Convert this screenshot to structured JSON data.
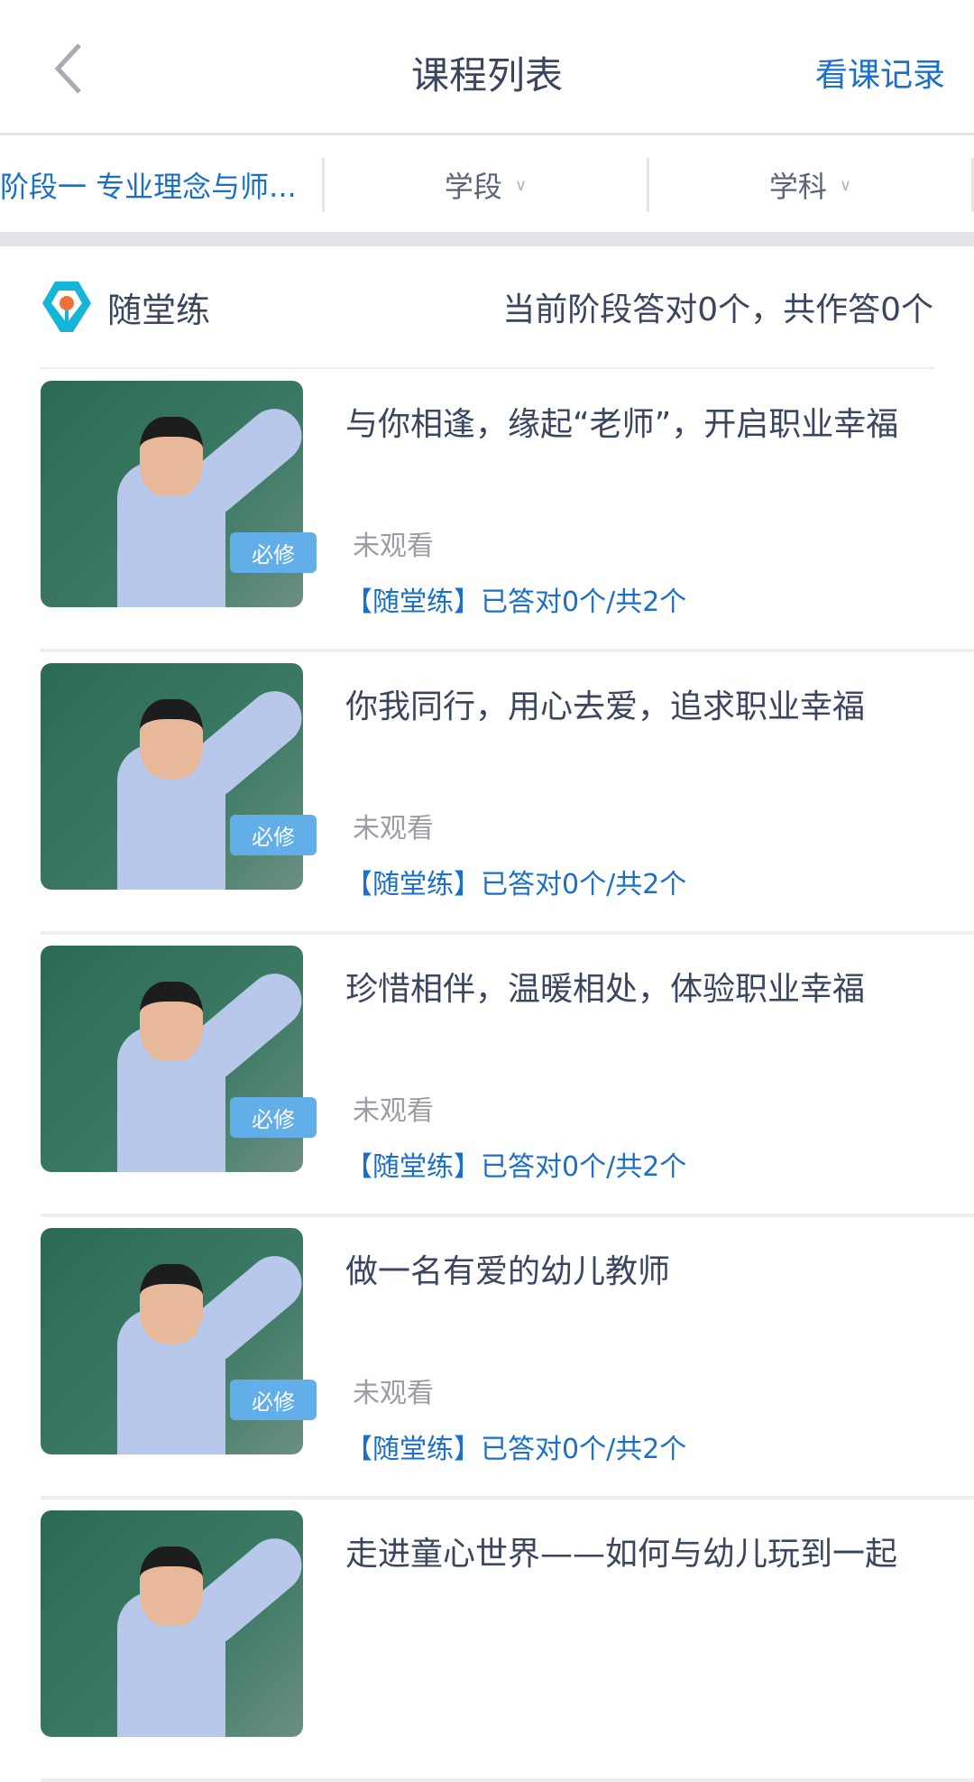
{
  "header": {
    "title": "课程列表",
    "history_label": "看课记录"
  },
  "filters": [
    {
      "label": "阶段一 专业理念与师..."
    },
    {
      "label": "学段"
    },
    {
      "label": "学科"
    }
  ],
  "practice": {
    "label": "随堂练",
    "stats": "当前阶段答对0个，共作答0个"
  },
  "courses": [
    {
      "title": "与你相逢，缘起“老师”，开启职业幸福",
      "badge": "必修",
      "status": "未观看",
      "quiz": "【随堂练】已答对0个/共2个"
    },
    {
      "title": "你我同行，用心去爱，追求职业幸福",
      "badge": "必修",
      "status": "未观看",
      "quiz": "【随堂练】已答对0个/共2个"
    },
    {
      "title": "珍惜相伴，温暖相处，体验职业幸福",
      "badge": "必修",
      "status": "未观看",
      "quiz": "【随堂练】已答对0个/共2个"
    },
    {
      "title": "做一名有爱的幼儿教师",
      "badge": "必修",
      "status": "未观看",
      "quiz": "【随堂练】已答对0个/共2个"
    },
    {
      "title": "走进童心世界——如何与幼儿玩到一起"
    }
  ]
}
